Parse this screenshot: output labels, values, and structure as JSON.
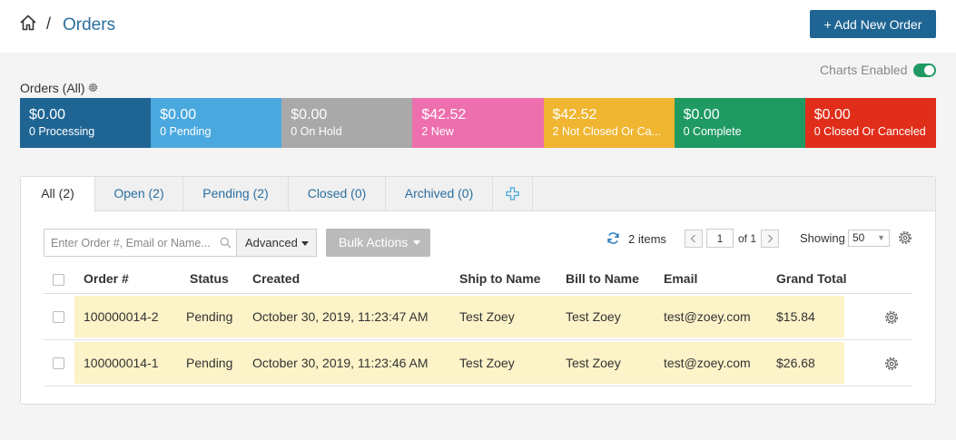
{
  "header": {
    "breadcrumb_sep": "/",
    "title": "Orders",
    "add_button": "+ Add New Order"
  },
  "charts": {
    "label": "Charts Enabled",
    "enabled": true,
    "toggle_color": "#1f9a63"
  },
  "orders_section": {
    "title": "Orders (All)"
  },
  "tiles": [
    {
      "amount": "$0.00",
      "label": "0 Processing",
      "color": "#1f6594"
    },
    {
      "amount": "$0.00",
      "label": "0 Pending",
      "color": "#4aa8de"
    },
    {
      "amount": "$0.00",
      "label": "0 On Hold",
      "color": "#a9a9a9"
    },
    {
      "amount": "$42.52",
      "label": "2 New",
      "color": "#ee6fae"
    },
    {
      "amount": "$42.52",
      "label": "2 Not Closed Or Ca...",
      "color": "#f0b531"
    },
    {
      "amount": "$0.00",
      "label": "0 Complete",
      "color": "#1f9a63"
    },
    {
      "amount": "$0.00",
      "label": "0 Closed Or Canceled",
      "color": "#e02e1a"
    }
  ],
  "tabs": [
    {
      "label": "All (2)",
      "active": true
    },
    {
      "label": "Open (2)",
      "active": false
    },
    {
      "label": "Pending (2)",
      "active": false
    },
    {
      "label": "Closed (0)",
      "active": false
    },
    {
      "label": "Archived (0)",
      "active": false
    }
  ],
  "toolbar": {
    "search_placeholder": "Enter Order #, Email or Name...",
    "advanced_label": "Advanced",
    "bulk_label": "Bulk Actions",
    "items_count": "2 items",
    "page": "1",
    "page_of": "of 1",
    "showing_label": "Showing",
    "per_page": "50"
  },
  "table": {
    "columns": [
      "Order #",
      "Status",
      "Created",
      "Ship to Name",
      "Bill to Name",
      "Email",
      "Grand Total"
    ],
    "rows": [
      [
        "100000014-2",
        "Pending",
        "October 30, 2019, 11:23:47 AM",
        "Test Zoey",
        "Test Zoey",
        "test@zoey.com",
        "$15.84"
      ],
      [
        "100000014-1",
        "Pending",
        "October 30, 2019, 11:23:46 AM",
        "Test Zoey",
        "Test Zoey",
        "test@zoey.com",
        "$26.68"
      ]
    ]
  },
  "colors": {
    "accent": "#1f6594",
    "link": "#2a6fa0",
    "row_highlight": "#fcf3c8"
  },
  "icons": {
    "home": "home-icon",
    "gear": "gear-icon",
    "search": "search-icon",
    "refresh": "refresh-icon",
    "add_tab": "plus-icon"
  }
}
